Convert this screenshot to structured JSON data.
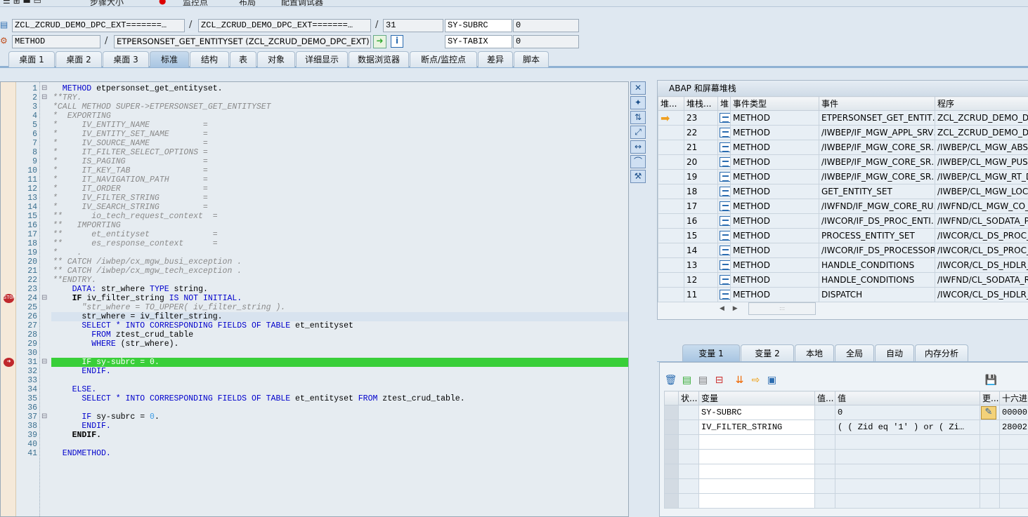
{
  "toolbar": {
    "items": [
      "步骤大小",
      "监控点",
      "布局",
      "配置调试器"
    ]
  },
  "header": {
    "program": "ZCL_ZCRUD_DEMO_DPC_EXT=======…",
    "include": "ZCL_ZCRUD_DEMO_DPC_EXT=======…",
    "line": "31",
    "sysfield1": "SY-SUBRC",
    "sysvalue1": "0",
    "event_type": "METHOD",
    "event": "ETPERSONSET_GET_ENTITYSET (ZCL_ZCRUD_DEMO_DPC_EXT)",
    "sysfield2": "SY-TABIX",
    "sysvalue2": "0",
    "slash": "/"
  },
  "tabs": [
    {
      "label": "桌面 1"
    },
    {
      "label": "桌面 2"
    },
    {
      "label": "桌面 3"
    },
    {
      "label": "标准",
      "active": true
    },
    {
      "label": "结构"
    },
    {
      "label": "表"
    },
    {
      "label": "对象"
    },
    {
      "label": "详细显示"
    },
    {
      "label": "数据浏览器"
    },
    {
      "label": "断点/监控点"
    },
    {
      "label": "差异"
    },
    {
      "label": "脚本"
    }
  ],
  "code": {
    "current_line": 31,
    "breakpoint_lines": [
      24,
      31
    ],
    "highlight_line": 26,
    "lines": [
      [
        [
          "kw",
          "  METHOD"
        ],
        [
          "tx",
          " etpersonset_get_entityset."
        ]
      ],
      [
        [
          "cm",
          "**TRY."
        ]
      ],
      [
        [
          "cm",
          "*CALL METHOD SUPER->ETPERSONSET_GET_ENTITYSET"
        ]
      ],
      [
        [
          "cm",
          "*  EXPORTING"
        ]
      ],
      [
        [
          "cm",
          "*     IV_ENTITY_NAME           ="
        ]
      ],
      [
        [
          "cm",
          "*     IV_ENTITY_SET_NAME       ="
        ]
      ],
      [
        [
          "cm",
          "*     IV_SOURCE_NAME           ="
        ]
      ],
      [
        [
          "cm",
          "*     IT_FILTER_SELECT_OPTIONS ="
        ]
      ],
      [
        [
          "cm",
          "*     IS_PAGING                ="
        ]
      ],
      [
        [
          "cm",
          "*     IT_KEY_TAB               ="
        ]
      ],
      [
        [
          "cm",
          "*     IT_NAVIGATION_PATH       ="
        ]
      ],
      [
        [
          "cm",
          "*     IT_ORDER                 ="
        ]
      ],
      [
        [
          "cm",
          "*     IV_FILTER_STRING         ="
        ]
      ],
      [
        [
          "cm",
          "*     IV_SEARCH_STRING         ="
        ]
      ],
      [
        [
          "cm",
          "**      io_tech_request_context  ="
        ]
      ],
      [
        [
          "cm",
          "**   IMPORTING"
        ]
      ],
      [
        [
          "cm",
          "**      et_entityset             ="
        ]
      ],
      [
        [
          "cm",
          "**      es_response_context      ="
        ]
      ],
      [
        [
          "cm",
          "*    ."
        ]
      ],
      [
        [
          "cm",
          "** CATCH /iwbep/cx_mgw_busi_exception ."
        ]
      ],
      [
        [
          "cm",
          "** CATCH /iwbep/cx_mgw_tech_exception ."
        ]
      ],
      [
        [
          "cm",
          "**ENDTRY."
        ]
      ],
      [
        [
          "kw",
          "    DATA:"
        ],
        [
          "tx",
          " str_where "
        ],
        [
          "kw",
          "TYPE"
        ],
        [
          "tx",
          " string."
        ]
      ],
      [
        [
          "kb",
          "    IF"
        ],
        [
          "tx",
          " iv_filter_string "
        ],
        [
          "kw",
          "IS NOT INITIAL."
        ]
      ],
      [
        [
          "cm",
          "      \"str_where = TO_UPPER( iv_filter_string )."
        ]
      ],
      [
        [
          "tx",
          "      str_where = iv_filter_string."
        ]
      ],
      [
        [
          "kw",
          "      SELECT * INTO CORRESPONDING FIELDS OF TABLE"
        ],
        [
          "tx",
          " et_entityset"
        ]
      ],
      [
        [
          "kw",
          "        FROM"
        ],
        [
          "tx",
          " ztest_crud_table"
        ]
      ],
      [
        [
          "kw",
          "        WHERE"
        ],
        [
          "tx",
          " (str_where)."
        ]
      ],
      [],
      [
        [
          "kw",
          "      IF"
        ],
        [
          "tx",
          " sy-subrc = "
        ],
        [
          "num",
          "0"
        ],
        [
          "tx",
          "."
        ]
      ],
      [
        [
          "kw",
          "      ENDIF."
        ]
      ],
      [],
      [
        [
          "kw",
          "    ELSE."
        ]
      ],
      [
        [
          "kw",
          "      SELECT * INTO CORRESPONDING FIELDS OF TABLE"
        ],
        [
          "tx",
          " et_entityset "
        ],
        [
          "kw",
          "FROM"
        ],
        [
          "tx",
          " ztest_crud_table."
        ]
      ],
      [],
      [
        [
          "kw",
          "      IF"
        ],
        [
          "tx",
          " sy-subrc = "
        ],
        [
          "num",
          "0"
        ],
        [
          "tx",
          "."
        ]
      ],
      [
        [
          "kw",
          "      ENDIF."
        ]
      ],
      [
        [
          "kb",
          "    ENDIF."
        ]
      ],
      [],
      [
        [
          "kw",
          "  ENDMETHOD."
        ]
      ]
    ]
  },
  "stack": {
    "title": "ABAP 和屏幕堆栈",
    "columns": [
      "堆...",
      "堆栈...",
      "堆",
      "事件类型",
      "事件",
      "程序"
    ],
    "rows": [
      {
        "level": "23",
        "type": "METHOD",
        "event": "ETPERSONSET_GET_ENTIT…",
        "program": "ZCL_ZCRUD_DEMO_DPC",
        "current": true
      },
      {
        "level": "22",
        "type": "METHOD",
        "event": "/IWBEP/IF_MGW_APPL_SRV…",
        "program": "ZCL_ZCRUD_DEMO_DPC"
      },
      {
        "level": "21",
        "type": "METHOD",
        "event": "/IWBEP/IF_MGW_CORE_SR…",
        "program": "/IWBEP/CL_MGW_ABS_"
      },
      {
        "level": "20",
        "type": "METHOD",
        "event": "/IWBEP/IF_MGW_CORE_SR…",
        "program": "/IWBEP/CL_MGW_PUSH"
      },
      {
        "level": "19",
        "type": "METHOD",
        "event": "/IWBEP/IF_MGW_CORE_SR…",
        "program": "/IWBEP/CL_MGW_RT_D"
      },
      {
        "level": "18",
        "type": "METHOD",
        "event": "GET_ENTITY_SET",
        "program": "/IWBEP/CL_MGW_LOCA"
      },
      {
        "level": "17",
        "type": "METHOD",
        "event": "/IWFND/IF_MGW_CORE_RU…",
        "program": "/IWFND/CL_MGW_CO_D"
      },
      {
        "level": "16",
        "type": "METHOD",
        "event": "/IWCOR/IF_DS_PROC_ENTI…",
        "program": "/IWFND/CL_SODATA_P"
      },
      {
        "level": "15",
        "type": "METHOD",
        "event": "PROCESS_ENTITY_SET",
        "program": "/IWCOR/CL_DS_PROC_D"
      },
      {
        "level": "14",
        "type": "METHOD",
        "event": "/IWCOR/IF_DS_PROCESSOR…",
        "program": "/IWCOR/CL_DS_PROC_D"
      },
      {
        "level": "13",
        "type": "METHOD",
        "event": "HANDLE_CONDITIONS",
        "program": "/IWCOR/CL_DS_HDLR_R"
      },
      {
        "level": "12",
        "type": "METHOD",
        "event": "HANDLE_CONDITIONS",
        "program": "/IWFND/CL_SODATA_R"
      },
      {
        "level": "11",
        "type": "METHOD",
        "event": "DISPATCH",
        "program": "/IWCOR/CL_DS_HDLR_R"
      }
    ]
  },
  "variables": {
    "tabs": [
      {
        "label": "变量 1",
        "active": true
      },
      {
        "label": "变量 2"
      },
      {
        "label": "本地"
      },
      {
        "label": "全局"
      },
      {
        "label": "自动"
      },
      {
        "label": "内存分析"
      }
    ],
    "columns": [
      "状...",
      "变量",
      "值...",
      "值",
      "更...",
      "十六进"
    ],
    "rows": [
      {
        "name": "SY-SUBRC",
        "value": "0",
        "hex": "00000",
        "editable": true
      },
      {
        "name": "IV_FILTER_STRING",
        "value": "( ( Zid eq '1' ) or ( Zi…",
        "hex": "28002"
      }
    ]
  }
}
